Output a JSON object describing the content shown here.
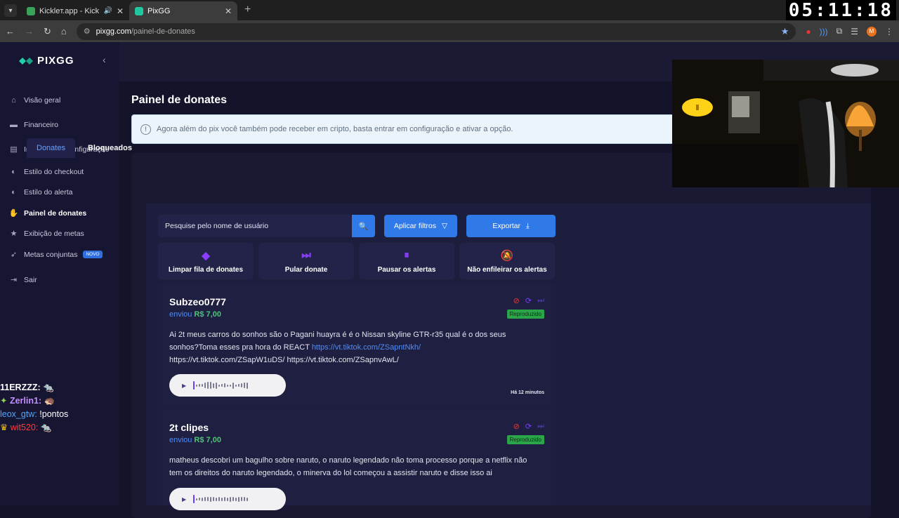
{
  "browser": {
    "tabs": [
      {
        "title": "Kickleт.app - Kick Chatbot a",
        "active": false
      },
      {
        "title": "PixGG",
        "active": true
      }
    ],
    "url_host": "pixgg.com",
    "url_path": "/painel-de-donates",
    "clock": "05:11:18",
    "profile_initial": "M"
  },
  "sidebar": {
    "brand": "PIXGG",
    "items": [
      {
        "label": "Visão geral",
        "icon": "home-icon"
      },
      {
        "label": "Financeiro",
        "icon": "wallet-icon"
      },
      {
        "label": "Integração e configuração",
        "icon": "settings-icon"
      },
      {
        "label": "Estilo do checkout",
        "icon": "palette-icon"
      },
      {
        "label": "Estilo do alerta",
        "icon": "palette-icon"
      },
      {
        "label": "Painel de donates",
        "icon": "hand-coins-icon"
      },
      {
        "label": "Exibição de metas",
        "icon": "star-icon"
      },
      {
        "label": "Metas conjuntas",
        "icon": "rocket-icon",
        "badge": "NOVO"
      },
      {
        "label": "Sair",
        "icon": "logout-icon"
      }
    ]
  },
  "chat_overlay": [
    {
      "user": "11ERZZZ:",
      "text": ""
    },
    {
      "user": "Zerlin1:",
      "text": ""
    },
    {
      "user": "leox_gtw:",
      "text": "!pontos"
    },
    {
      "user": "wit520:",
      "text": ""
    }
  ],
  "page": {
    "title": "Painel de donates",
    "info": "Agora além do pix você também pode receber em cripto, basta entrar em configuração e ativar a opção.",
    "tabs": [
      "Donates",
      "Bloqueados"
    ],
    "search_placeholder": "Pesquise pelo nome de usuário",
    "filters_label": "Aplicar filtros",
    "export_label": "Exportar",
    "actions": [
      {
        "label": "Limpar fila de donates",
        "icon": "eraser-icon"
      },
      {
        "label": "Pular donate",
        "icon": "skip-icon"
      },
      {
        "label": "Pausar os alertas",
        "icon": "pause-icon"
      },
      {
        "label": "Não enfileirar os alertas",
        "icon": "bell-off-icon"
      }
    ]
  },
  "donations": [
    {
      "name": "Subzeo0777",
      "sent": "enviou",
      "amount": "R$ 7,00",
      "status": "Reproduzido",
      "message": "Ai 2t meus carros do sonhos são o Pagani huayra é é o Nissan skyline GTR-r35 qual é o dos seus sonhos?Toma esses pra hora do REACT",
      "link": "https://vt.tiktok.com/ZSapntNkh/",
      "message_tail": "https://vt.tiktok.com/ZSapW1uDS/ https://vt.tiktok.com/ZSapnvAwL/",
      "ago": "Há 12 minutos"
    },
    {
      "name": "2t clipes",
      "sent": "enviou",
      "amount": "R$ 7,00",
      "status": "Reproduzido",
      "message": "matheus descobri um bagulho sobre naruto, o naruto legendado não toma processo porque a netflix não tem os direitos do naruto legendado, o minerva do lol começou a assistir naruto e disse isso ai",
      "ago": ""
    }
  ]
}
